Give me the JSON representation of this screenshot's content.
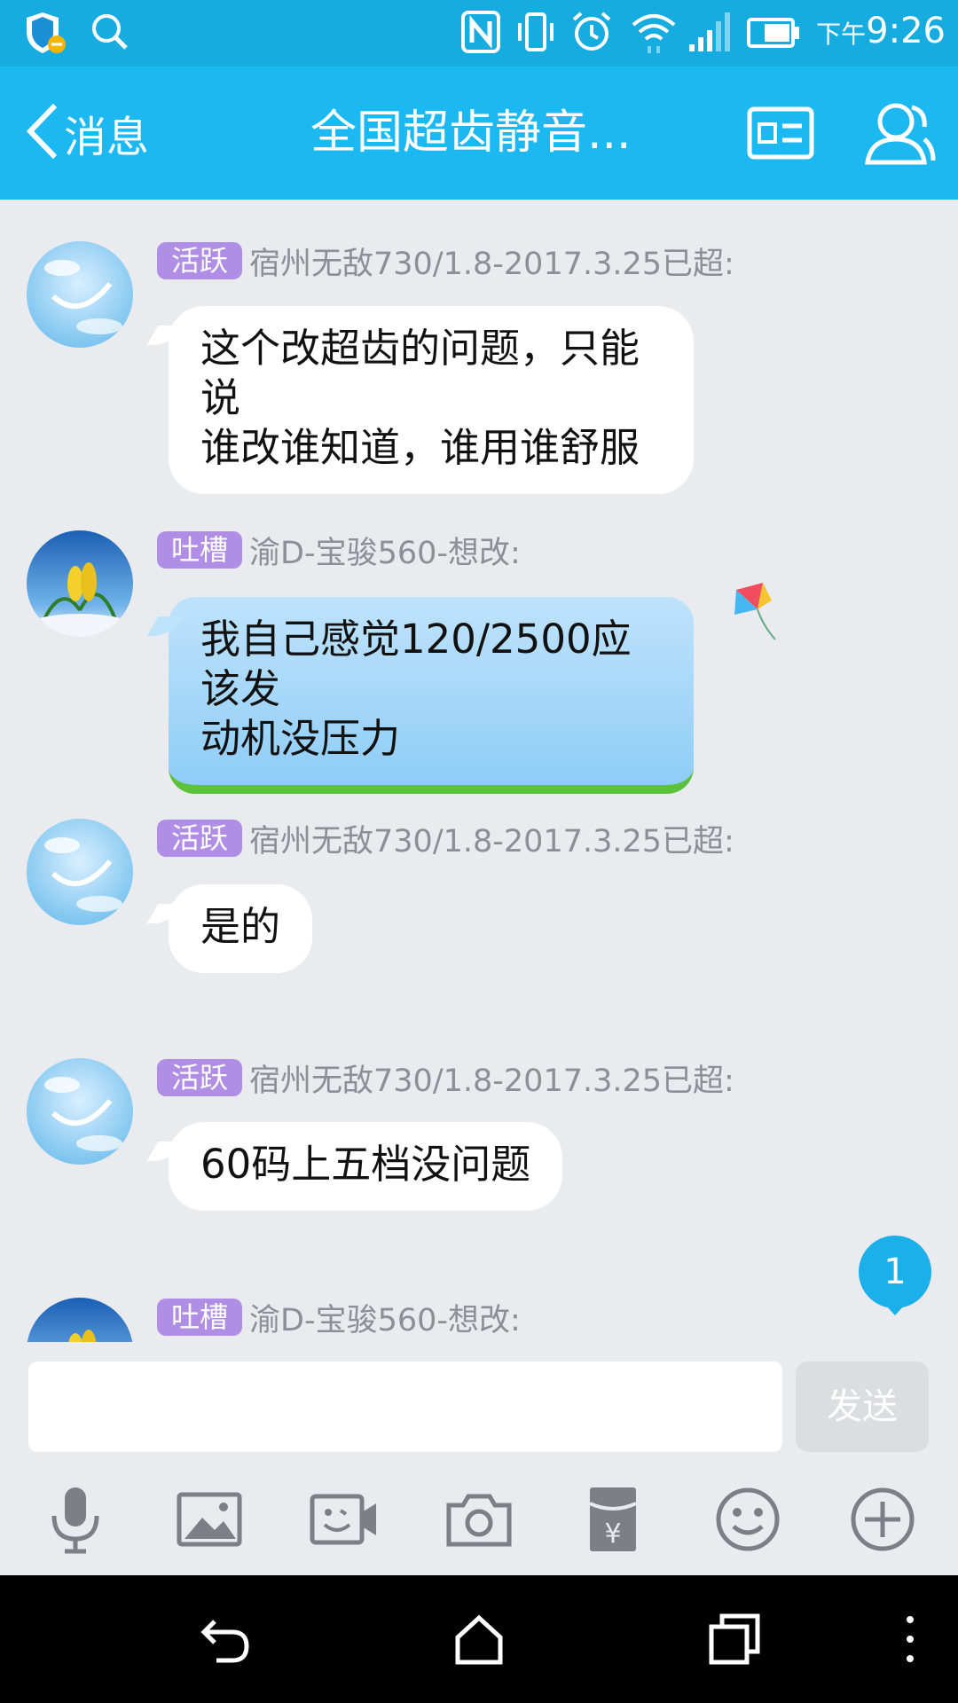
{
  "status_bar": {
    "time_prefix": "下午",
    "time": "9:26"
  },
  "header": {
    "back_label": "消息",
    "title": "全国超齿静音..."
  },
  "messages": [
    {
      "tag": "活跃",
      "sender": "宿州无敌730/1.8-2017.3.25已超:",
      "text_line1": "这个改超齿的问题，只能说",
      "text_line2": "谁改谁知道，谁用谁舒服"
    },
    {
      "tag": "吐槽",
      "sender": "渝D-宝骏560-想改:",
      "text_line1": "我自己感觉120/2500应该发",
      "text_line2": "动机没压力"
    },
    {
      "tag": "活跃",
      "sender": "宿州无敌730/1.8-2017.3.25已超:",
      "text_line1": "是的"
    },
    {
      "tag": "活跃",
      "sender": "宿州无敌730/1.8-2017.3.25已超:",
      "text_line1": "60码上五档没问题"
    },
    {
      "tag": "吐槽",
      "sender": "渝D-宝骏560-想改:"
    }
  ],
  "unread_count": "1",
  "composer": {
    "send_label": "发送"
  },
  "toolbar_icons": [
    "microphone-icon",
    "image-icon",
    "video-call-icon",
    "camera-icon",
    "red-packet-icon",
    "emoji-icon",
    "plus-icon"
  ],
  "colors": {
    "header": "#1cb8f2",
    "tag": "#b08ee6",
    "background": "#eaebef"
  }
}
